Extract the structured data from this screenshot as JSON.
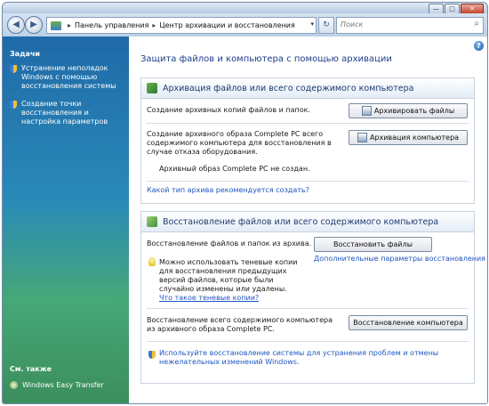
{
  "window": {
    "caption_buttons": [
      "—",
      "□",
      "✕"
    ]
  },
  "nav": {
    "back_icon": "back-arrow-icon",
    "forward_icon": "forward-arrow-icon",
    "breadcrumbs": [
      "Панель управления",
      "Центр архивации и восстановления"
    ],
    "search_placeholder": "Поиск"
  },
  "tasks": {
    "header": "Задачи",
    "items": [
      {
        "label": "Устранение неполадок Windows с помощью восстановления системы",
        "icon": "shield-icon"
      },
      {
        "label": "Создание точки восстановления и настройка параметров",
        "icon": "shield-icon"
      }
    ],
    "see_also_header": "См. также",
    "see_also_items": [
      {
        "label": "Windows Easy Transfer",
        "icon": "easy-transfer-icon"
      }
    ]
  },
  "main": {
    "title": "Защита файлов и компьютера с помощью архивации",
    "backup": {
      "header": "Архивация файлов или всего содержимого компьютера",
      "files_text": "Создание архивных копий файлов и папок.",
      "files_button": "Архивировать файлы",
      "pc_text": "Создание архивного образа Complete PC всего содержимого компьютера для восстановления в случае отказа оборудования.",
      "pc_button": "Архивация компьютера",
      "status_text": "Архивный образ Complete PC не создан.",
      "link": "Какой тип архива рекомендуется создать?"
    },
    "restore": {
      "header": "Восстановление файлов или всего содержимого компьютера",
      "files_text": "Восстановление файлов и папок из архива.",
      "files_button": "Восстановить файлы",
      "advanced_link": "Дополнительные параметры восстановления",
      "tip_text": "Можно использовать теневые копии для восстановления предыдущих версий файлов, которые были случайно изменены или удалены.",
      "tip_link": "Что такое теневые копии?",
      "pc_text": "Восстановление всего содержимого компьютера из архивного образа Complete PC.",
      "pc_button": "Восстановление компьютера",
      "system_restore_text": "Используйте восстановление системы для устранения проблем и отмены нежелательных изменений Windows."
    }
  }
}
